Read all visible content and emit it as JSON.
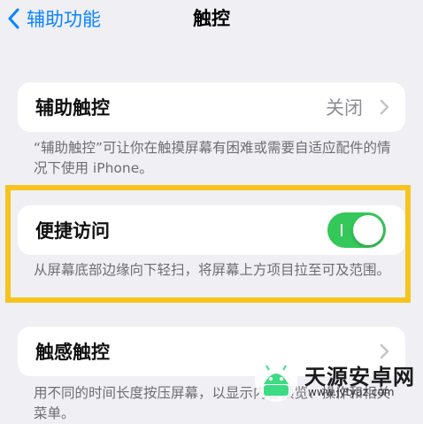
{
  "nav": {
    "back_label": "辅助功能",
    "title": "触控"
  },
  "assistive_touch": {
    "label": "辅助触控",
    "value": "关闭",
    "footnote": "“辅助触控”可让你在触摸屏幕有困难或需要自适应配件的情况下使用 iPhone。"
  },
  "reachability": {
    "label": "便捷访问",
    "toggle_on": true,
    "footnote": "从屏幕底部边缘向下轻扫，将屏幕上方项目拉至可及范围。"
  },
  "haptic_touch": {
    "label": "触感触控",
    "footnote": "用不同的时间长度按压屏幕，以显示内容预览、操作和相关菜单。"
  },
  "watermark": {
    "text": "天源安卓网",
    "url": "www.jytyaz.com"
  },
  "colors": {
    "accent": "#0a84ff",
    "toggle_on": "#34c759",
    "highlight": "#f6c41f",
    "background": "#efeff4"
  }
}
